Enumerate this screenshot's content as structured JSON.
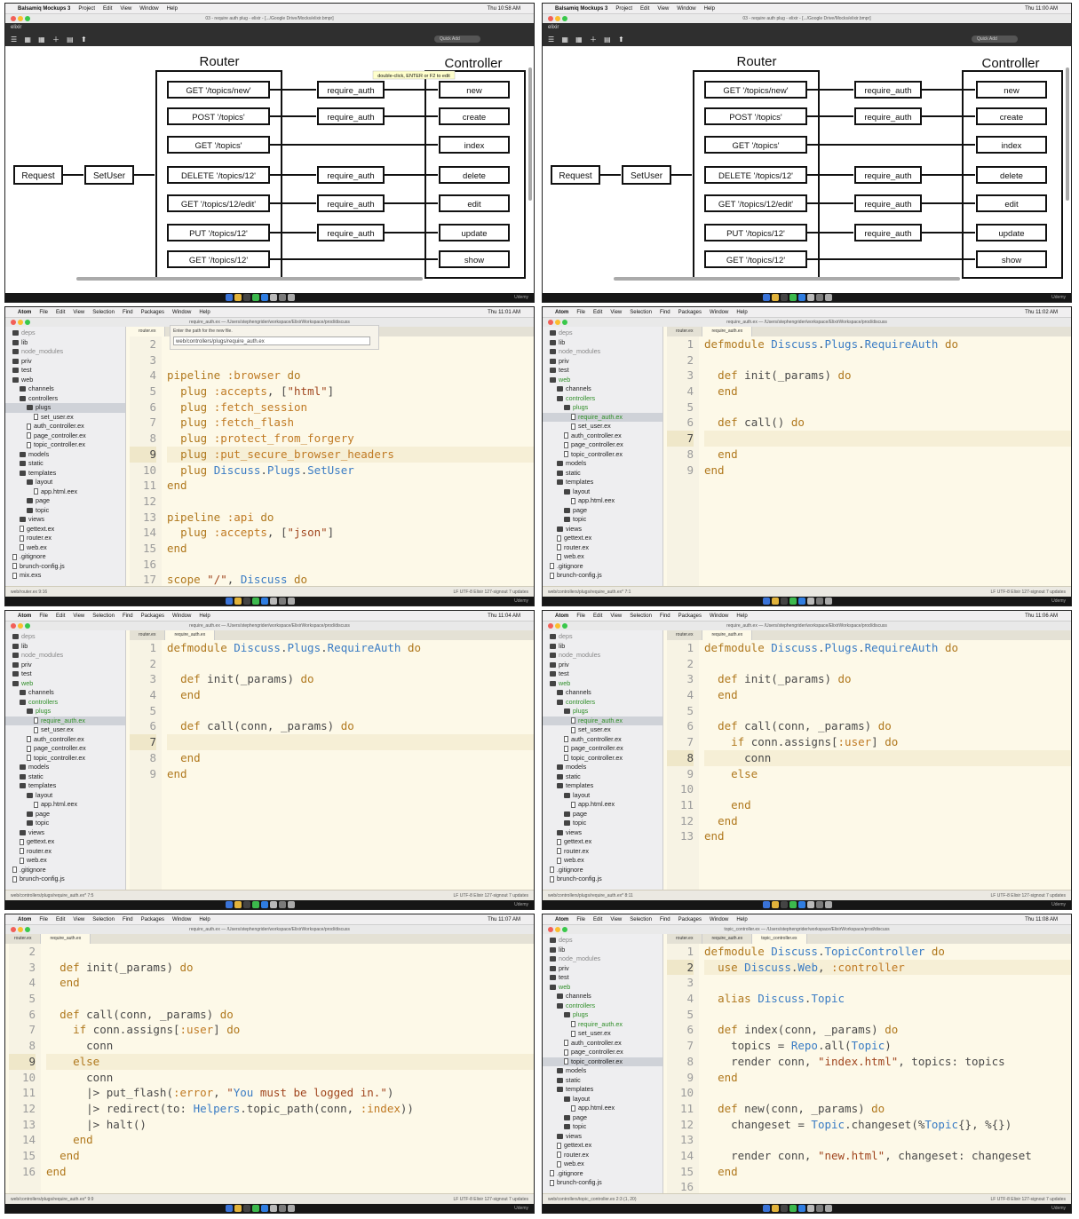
{
  "mock_menubar": {
    "apple": "",
    "app": "Balsamiq Mockups 3",
    "items": [
      "Project",
      "Edit",
      "View",
      "Window",
      "Help"
    ]
  },
  "atom_menubar": {
    "apple": "",
    "app": "Atom",
    "items": [
      "File",
      "Edit",
      "View",
      "Selection",
      "Find",
      "Packages",
      "Window",
      "Help"
    ]
  },
  "mock_window": {
    "title": "03 - require auth plug - elixir - [.../Google Drive/Mocks/elixir.bmpr]",
    "toolbar_label": "elixir",
    "quick_add": "Quick Add"
  },
  "diagram": {
    "router_label": "Router",
    "controller_label": "Controller",
    "tooltip": "double-click, ENTER or F2 to edit",
    "request": "Request",
    "setuser": "SetUser",
    "rows": [
      {
        "route": "GET '/topics/new'",
        "plug": "require_auth",
        "action": "new"
      },
      {
        "route": "POST '/topics'",
        "plug": "require_auth",
        "action": "create"
      },
      {
        "route": "GET '/topics'",
        "plug": "",
        "action": "index"
      },
      {
        "route": "DELETE '/topics/12'",
        "plug": "require_auth",
        "action": "delete"
      },
      {
        "route": "GET '/topics/12/edit'",
        "plug": "require_auth",
        "action": "edit"
      },
      {
        "route": "PUT '/topics/12'",
        "plug": "require_auth",
        "action": "update"
      },
      {
        "route": "GET '/topics/12'",
        "plug": "",
        "action": "show"
      }
    ]
  },
  "udemy": "Udemy",
  "panels": [
    {
      "clock": "Thu 10:58 AM"
    },
    {
      "clock": "Thu 11:00 AM"
    },
    {
      "clock": "Thu 11:01 AM",
      "title": "require_auth.ex — /Users/stephengrider/workspace/ElixirWorkspace/prod/discuss",
      "tabs": [
        "router.ex"
      ],
      "find_hint": "Enter the path for the new file.",
      "find_value": "web/controllers/plugs/require_auth.ex",
      "status_left": "web/router.ex  9:16",
      "status_right": "LF  UTF-8  Elixir  127-signout  7 updates",
      "gutter": [
        "2",
        "3",
        "4",
        "5",
        "6",
        "7",
        "8",
        "9",
        "10",
        "11",
        "12",
        "13",
        "14",
        "15",
        "16",
        "17"
      ],
      "cur": 7,
      "code": [
        "",
        "",
        "pipeline :browser do",
        "  plug :accepts, [\"html\"]",
        "  plug :fetch_session",
        "  plug :fetch_flash",
        "  plug :protect_from_forgery",
        "  plug :put_secure_browser_headers",
        "  plug Discuss.Plugs.SetUser",
        "end",
        "",
        "pipeline :api do",
        "  plug :accepts, [\"json\"]",
        "end",
        "",
        "scope \"/\", Discuss do"
      ]
    },
    {
      "clock": "Thu 11:02 AM",
      "title": "require_auth.ex — /Users/stephengrider/workspace/ElixirWorkspace/prod/discuss",
      "tabs": [
        "router.ex",
        "require_auth.ex"
      ],
      "status_left": "web/controllers/plugs/require_auth.ex*  7:1",
      "status_right": "LF  UTF-8  Elixir  127-signout  7 updates",
      "gutter": [
        "1",
        "2",
        "3",
        "4",
        "5",
        "6",
        "7",
        "8",
        "9"
      ],
      "cur": 6,
      "code": [
        "defmodule Discuss.Plugs.RequireAuth do",
        "",
        "  def init(_params) do",
        "  end",
        "",
        "  def call() do",
        "",
        "  end",
        "end"
      ]
    },
    {
      "clock": "Thu 11:04 AM",
      "title": "require_auth.ex — /Users/stephengrider/workspace/ElixirWorkspace/prod/discuss",
      "tabs": [
        "router.ex",
        "require_auth.ex"
      ],
      "status_left": "web/controllers/plugs/require_auth.ex*  7:5",
      "status_right": "LF  UTF-8  Elixir  127-signout  7 updates",
      "gutter": [
        "1",
        "2",
        "3",
        "4",
        "5",
        "6",
        "7",
        "8",
        "9"
      ],
      "cur": 6,
      "code": [
        "defmodule Discuss.Plugs.RequireAuth do",
        "",
        "  def init(_params) do",
        "  end",
        "",
        "  def call(conn, _params) do",
        "    ",
        "  end",
        "end"
      ]
    },
    {
      "clock": "Thu 11:06 AM",
      "title": "require_auth.ex — /Users/stephengrider/workspace/ElixirWorkspace/prod/discuss",
      "tabs": [
        "router.ex",
        "require_auth.ex"
      ],
      "status_left": "web/controllers/plugs/require_auth.ex*  8:11",
      "status_right": "LF  UTF-8  Elixir  127-signout  7 updates",
      "gutter": [
        "1",
        "2",
        "3",
        "4",
        "5",
        "6",
        "7",
        "8",
        "9",
        "10",
        "11",
        "12",
        "13"
      ],
      "cur": 7,
      "code": [
        "defmodule Discuss.Plugs.RequireAuth do",
        "",
        "  def init(_params) do",
        "  end",
        "",
        "  def call(conn, _params) do",
        "    if conn.assigns[:user] do",
        "      conn",
        "    else",
        "",
        "    end",
        "  end",
        "end"
      ]
    },
    {
      "clock": "Thu 11:07 AM",
      "title": "require_auth.ex — /Users/stephengrider/workspace/ElixirWorkspace/prod/discuss",
      "tabs": [
        "router.ex",
        "require_auth.ex"
      ],
      "status_left": "web/controllers/plugs/require_auth.ex*  9:9",
      "status_right": "LF  UTF-8  Elixir  127-signout  7 updates",
      "gutter": [
        "2",
        "3",
        "4",
        "5",
        "6",
        "7",
        "8",
        "9",
        "10",
        "11",
        "12",
        "13",
        "14",
        "15",
        "16"
      ],
      "cur": 7,
      "code": [
        "",
        "  def init(_params) do",
        "  end",
        "",
        "  def call(conn, _params) do",
        "    if conn.assigns[:user] do",
        "      conn",
        "    else",
        "      conn",
        "      |> put_flash(:error, \"You must be logged in.\")",
        "      |> redirect(to: Helpers.topic_path(conn, :index))",
        "      |> halt()",
        "    end",
        "  end",
        "end"
      ]
    },
    {
      "clock": "Thu 11:08 AM",
      "title": "topic_controller.ex — /Users/stephengrider/workspace/ElixirWorkspace/prod/discuss",
      "tabs": [
        "router.ex",
        "require_auth.ex",
        "topic_controller.ex"
      ],
      "status_left": "web/controllers/topic_controller.ex  2:3  (1, 20)",
      "status_right": "LF  UTF-8  Elixir  127-signout  7 updates",
      "gutter": [
        "1",
        "2",
        "3",
        "4",
        "5",
        "6",
        "7",
        "8",
        "9",
        "10",
        "11",
        "12",
        "13",
        "14",
        "15",
        "16"
      ],
      "cur": 1,
      "code": [
        "defmodule Discuss.TopicController do",
        "  use Discuss.Web, :controller",
        "",
        "  alias Discuss.Topic",
        "",
        "  def index(conn, _params) do",
        "    topics = Repo.all(Topic)",
        "    render conn, \"index.html\", topics: topics",
        "  end",
        "",
        "  def new(conn, _params) do",
        "    changeset = Topic.changeset(%Topic{}, %{})",
        "",
        "    render conn, \"new.html\", changeset: changeset",
        "  end",
        ""
      ]
    }
  ],
  "tree_a": [
    {
      "t": "deps",
      "d": 0,
      "c": "dim",
      "f": 1
    },
    {
      "t": "lib",
      "d": 0,
      "f": 1
    },
    {
      "t": "node_modules",
      "d": 0,
      "c": "dim",
      "f": 1
    },
    {
      "t": "priv",
      "d": 0,
      "f": 1
    },
    {
      "t": "test",
      "d": 0,
      "f": 1
    },
    {
      "t": "web",
      "d": 0,
      "f": 1
    },
    {
      "t": "channels",
      "d": 1,
      "f": 1
    },
    {
      "t": "controllers",
      "d": 1,
      "f": 1
    },
    {
      "t": "plugs",
      "d": 2,
      "f": 1,
      "c": "sel"
    },
    {
      "t": "set_user.ex",
      "d": 3
    },
    {
      "t": "auth_controller.ex",
      "d": 2
    },
    {
      "t": "page_controller.ex",
      "d": 2
    },
    {
      "t": "topic_controller.ex",
      "d": 2
    },
    {
      "t": "models",
      "d": 1,
      "f": 1
    },
    {
      "t": "static",
      "d": 1,
      "f": 1
    },
    {
      "t": "templates",
      "d": 1,
      "f": 1
    },
    {
      "t": "layout",
      "d": 2,
      "f": 1
    },
    {
      "t": "app.html.eex",
      "d": 3
    },
    {
      "t": "page",
      "d": 2,
      "f": 1
    },
    {
      "t": "topic",
      "d": 2,
      "f": 1
    },
    {
      "t": "views",
      "d": 1,
      "f": 1
    },
    {
      "t": "gettext.ex",
      "d": 1
    },
    {
      "t": "router.ex",
      "d": 1
    },
    {
      "t": "web.ex",
      "d": 1
    },
    {
      "t": ".gitignore",
      "d": 0
    },
    {
      "t": "brunch-config.js",
      "d": 0
    },
    {
      "t": "mix.exs",
      "d": 0
    }
  ],
  "tree_b": [
    {
      "t": "deps",
      "d": 0,
      "c": "dim",
      "f": 1
    },
    {
      "t": "lib",
      "d": 0,
      "f": 1
    },
    {
      "t": "node_modules",
      "d": 0,
      "c": "dim",
      "f": 1
    },
    {
      "t": "priv",
      "d": 0,
      "f": 1
    },
    {
      "t": "test",
      "d": 0,
      "f": 1
    },
    {
      "t": "web",
      "d": 0,
      "f": 1,
      "c": "green"
    },
    {
      "t": "channels",
      "d": 1,
      "f": 1
    },
    {
      "t": "controllers",
      "d": 1,
      "f": 1,
      "c": "green"
    },
    {
      "t": "plugs",
      "d": 2,
      "f": 1,
      "c": "green"
    },
    {
      "t": "require_auth.ex",
      "d": 3,
      "c": "green sel"
    },
    {
      "t": "set_user.ex",
      "d": 3
    },
    {
      "t": "auth_controller.ex",
      "d": 2
    },
    {
      "t": "page_controller.ex",
      "d": 2
    },
    {
      "t": "topic_controller.ex",
      "d": 2
    },
    {
      "t": "models",
      "d": 1,
      "f": 1
    },
    {
      "t": "static",
      "d": 1,
      "f": 1
    },
    {
      "t": "templates",
      "d": 1,
      "f": 1
    },
    {
      "t": "layout",
      "d": 2,
      "f": 1
    },
    {
      "t": "app.html.eex",
      "d": 3
    },
    {
      "t": "page",
      "d": 2,
      "f": 1
    },
    {
      "t": "topic",
      "d": 2,
      "f": 1
    },
    {
      "t": "views",
      "d": 1,
      "f": 1
    },
    {
      "t": "gettext.ex",
      "d": 1
    },
    {
      "t": "router.ex",
      "d": 1
    },
    {
      "t": "web.ex",
      "d": 1
    },
    {
      "t": ".gitignore",
      "d": 0
    },
    {
      "t": "brunch-config.js",
      "d": 0
    }
  ],
  "tree_c": [
    {
      "t": "deps",
      "d": 0,
      "c": "dim",
      "f": 1
    },
    {
      "t": "lib",
      "d": 0,
      "f": 1
    },
    {
      "t": "node_modules",
      "d": 0,
      "c": "dim",
      "f": 1
    },
    {
      "t": "priv",
      "d": 0,
      "f": 1
    },
    {
      "t": "test",
      "d": 0,
      "f": 1
    },
    {
      "t": "web",
      "d": 0,
      "f": 1,
      "c": "green"
    },
    {
      "t": "channels",
      "d": 1,
      "f": 1
    },
    {
      "t": "controllers",
      "d": 1,
      "f": 1,
      "c": "green"
    },
    {
      "t": "plugs",
      "d": 2,
      "f": 1,
      "c": "green"
    },
    {
      "t": "require_auth.ex",
      "d": 3,
      "c": "green"
    },
    {
      "t": "set_user.ex",
      "d": 3
    },
    {
      "t": "auth_controller.ex",
      "d": 2
    },
    {
      "t": "page_controller.ex",
      "d": 2
    },
    {
      "t": "topic_controller.ex",
      "d": 2,
      "c": "sel"
    },
    {
      "t": "models",
      "d": 1,
      "f": 1
    },
    {
      "t": "static",
      "d": 1,
      "f": 1
    },
    {
      "t": "templates",
      "d": 1,
      "f": 1
    },
    {
      "t": "layout",
      "d": 2,
      "f": 1
    },
    {
      "t": "app.html.eex",
      "d": 3
    },
    {
      "t": "page",
      "d": 2,
      "f": 1
    },
    {
      "t": "topic",
      "d": 2,
      "f": 1
    },
    {
      "t": "views",
      "d": 1,
      "f": 1
    },
    {
      "t": "gettext.ex",
      "d": 1
    },
    {
      "t": "router.ex",
      "d": 1
    },
    {
      "t": "web.ex",
      "d": 1
    },
    {
      "t": ".gitignore",
      "d": 0
    },
    {
      "t": "brunch-config.js",
      "d": 0
    }
  ]
}
